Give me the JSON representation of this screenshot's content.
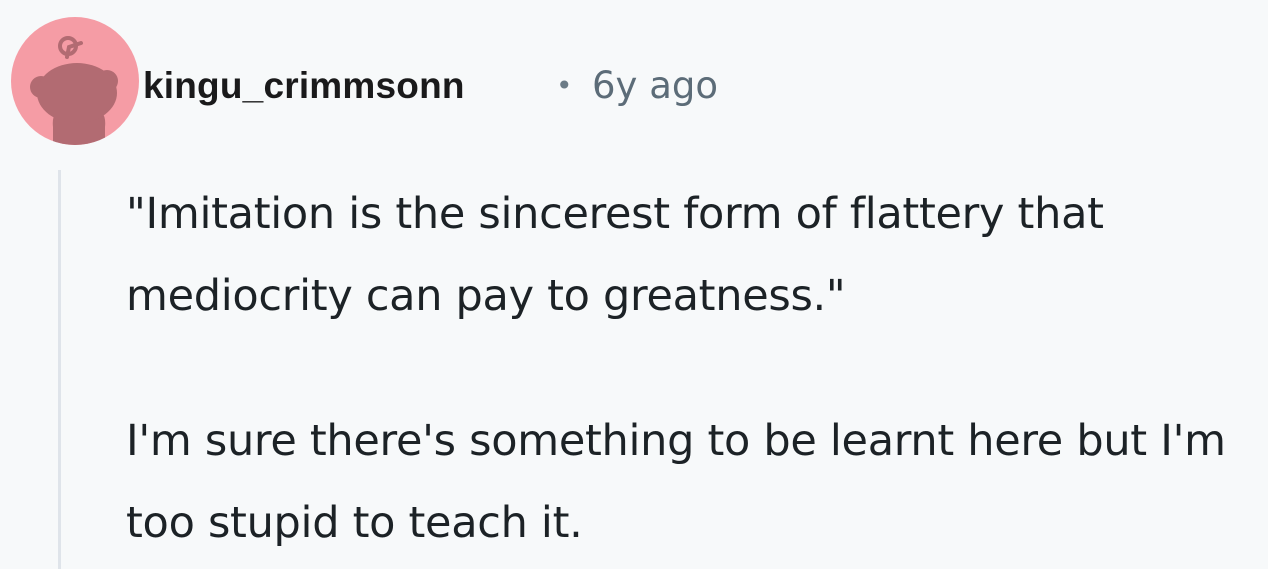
{
  "comment": {
    "author": "kingu_crimmsonn",
    "separator": "•",
    "timestamp": "6y ago",
    "avatar_icon": "reddit-snoo-avatar-icon",
    "paragraphs": [
      "\"Imitation is the sincerest form of flattery that mediocrity can pay to greatness.\"",
      "I'm sure there's something to be learnt here but I'm too stupid to teach it."
    ]
  },
  "colors": {
    "background": "#f7f9fa",
    "avatar_bg": "#f59ca5",
    "avatar_snoo": "#b26b72",
    "username": "#1a1a1b",
    "timestamp": "#5c6c78",
    "body_text": "#1c2226",
    "thread_line": "#dfe4ea"
  }
}
